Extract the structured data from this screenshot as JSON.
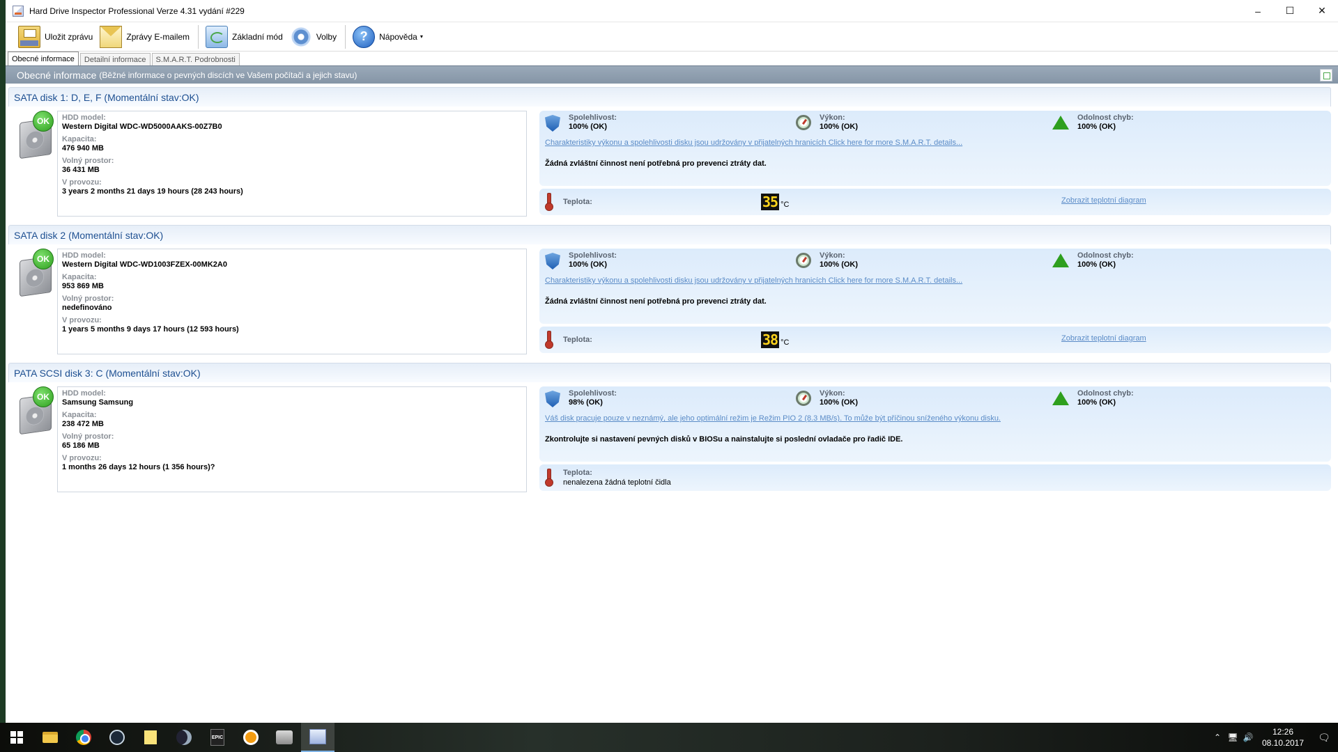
{
  "window": {
    "title": "Hard Drive Inspector Professional Verze 4.31 vydání #229",
    "controls": {
      "minimize": "–",
      "maximize": "☐",
      "close": "✕"
    }
  },
  "toolbar": {
    "save_label": "Uložit zprávu",
    "email_label": "Zprávy E-mailem",
    "basic_mode_label": "Základní mód",
    "options_label": "Volby",
    "help_label": "Nápověda",
    "help_caret": "▾",
    "help_glyph": "?"
  },
  "tabs": [
    {
      "label": "Obecné informace",
      "active": true
    },
    {
      "label": "Detailní informace",
      "active": false
    },
    {
      "label": "S.M.A.R.T. Podrobnosti",
      "active": false
    }
  ],
  "section": {
    "title": "Obecné informace",
    "subtitle": "(Běžné informace o pevných discích ve Vašem počítači a jejich stavu)"
  },
  "labels": {
    "ok": "OK",
    "model": "HDD model:",
    "capacity": "Kapacita:",
    "free": "Volný prostor:",
    "uptime": "V provozu:",
    "reliability": "Spolehlivost:",
    "performance": "Výkon:",
    "error_resistance": "Odolnost chyb:",
    "temperature": "Teplota:",
    "temp_unit": "°C",
    "temp_link": "Zobrazit teplotní diagram"
  },
  "disks": [
    {
      "title": "SATA disk 1: D, E, F (Momentální stav:OK)",
      "model": "Western Digital WDC-WD5000AAKS-00Z7B0",
      "capacity": "476 940 MB",
      "free": "36 431 MB",
      "uptime": "3 years 2 months 21 days 19 hours (28 243 hours)",
      "reliability": "100% (OK)",
      "performance": "100% (OK)",
      "error_resistance": "100% (OK)",
      "link": "Charakteristiky výkonu a spolehlivosti disku jsou udržovány v přijatelných hranicích Click here for more S.M.A.R.T. details...",
      "message": "Žádná zvláštní činnost není potřebná pro prevenci ztráty dat.",
      "temperature": "35"
    },
    {
      "title": "SATA disk 2 (Momentální stav:OK)",
      "model": "Western Digital WDC-WD1003FZEX-00MK2A0",
      "capacity": "953 869 MB",
      "free": "nedefinováno",
      "uptime": "1 years 5 months 9 days 17 hours (12 593 hours)",
      "reliability": "100% (OK)",
      "performance": "100% (OK)",
      "error_resistance": "100% (OK)",
      "link": "Charakteristiky výkonu a spolehlivosti disku jsou udržovány v přijatelných hranicích Click here for more S.M.A.R.T. details...",
      "message": "Žádná zvláštní činnost není potřebná pro prevenci ztráty dat.",
      "temperature": "38"
    },
    {
      "title": "PATA SCSI disk 3: C (Momentální stav:OK)",
      "model": "Samsung Samsung",
      "capacity": "238 472 MB",
      "free": "65 186 MB",
      "uptime": "1 months 26 days 12 hours (1 356 hours)?",
      "reliability": "98% (OK)",
      "performance": "100% (OK)",
      "error_resistance": "100% (OK)",
      "link": "Váš disk pracuje pouze v neznámý, ale jeho optimální režim je Režim PIO 2 (8.3 MB/s). To může být příčinou sníženého výkonu disku.",
      "message": "Zkontrolujte si nastavení pevných disků v BIOSu a nainstalujte si poslední ovladače pro řadič IDE.",
      "temperature_text": "nenalezena žádná teplotní čidla"
    }
  ],
  "taskbar": {
    "epic_text": "EPIC",
    "tray_glyphs": {
      "chevron": "⌃",
      "network": "🖥",
      "volume": "🔊",
      "notifications": "🗨"
    },
    "time": "12:26",
    "date": "08.10.2017"
  }
}
